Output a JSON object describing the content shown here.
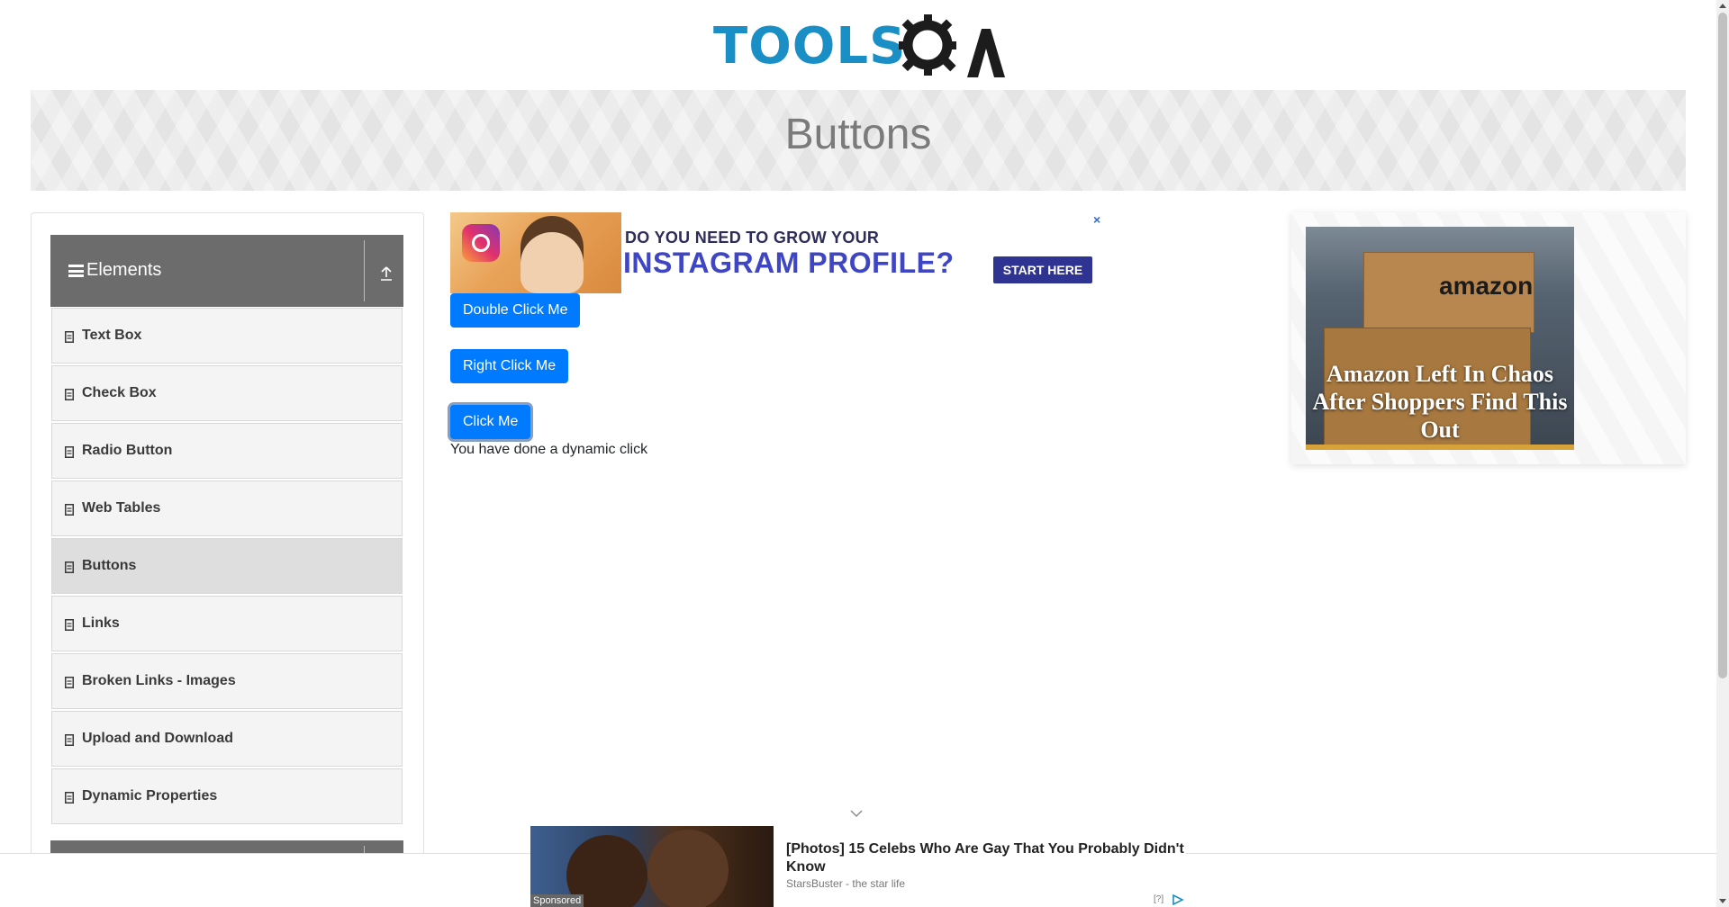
{
  "header": {
    "logo_text": "TOOLSQA",
    "logo_word": "TOOLS"
  },
  "banner": {
    "title": "Buttons"
  },
  "sidebar": {
    "group": {
      "label": "Elements",
      "icon": "hamburger-icon",
      "toggle_icon": "collapse-up-icon"
    },
    "items": [
      {
        "label": "Text Box",
        "active": false
      },
      {
        "label": "Check Box",
        "active": false
      },
      {
        "label": "Radio Button",
        "active": false
      },
      {
        "label": "Web Tables",
        "active": false
      },
      {
        "label": "Buttons",
        "active": true
      },
      {
        "label": "Links",
        "active": false
      },
      {
        "label": "Broken Links - Images",
        "active": false
      },
      {
        "label": "Upload and Download",
        "active": false
      },
      {
        "label": "Dynamic Properties",
        "active": false
      }
    ]
  },
  "ad_top": {
    "line1": "DO YOU NEED TO GROW YOUR",
    "line2": "INSTAGRAM PROFILE?",
    "cta": "START HERE",
    "close": "×"
  },
  "buttons": {
    "double_click": "Double Click Me",
    "right_click": "Right Click Me",
    "click": "Click Me",
    "dynamic_message": "You have done a dynamic click"
  },
  "ad_right": {
    "brand": "amazon",
    "headline": "Amazon Left In Chaos After Shoppers Find This Out"
  },
  "ad_bottom": {
    "title": "[Photos] 15 Celebs Who Are Gay That You Probably Didn't Know",
    "source": "StarsBuster - the star life",
    "sponsored": "Sponsored",
    "help": "[?]"
  },
  "colors": {
    "primary": "#007bff",
    "logo_blue": "#1a8fc6",
    "sidebar_header": "#6c6c6c",
    "ad_cta": "#2f3492"
  }
}
